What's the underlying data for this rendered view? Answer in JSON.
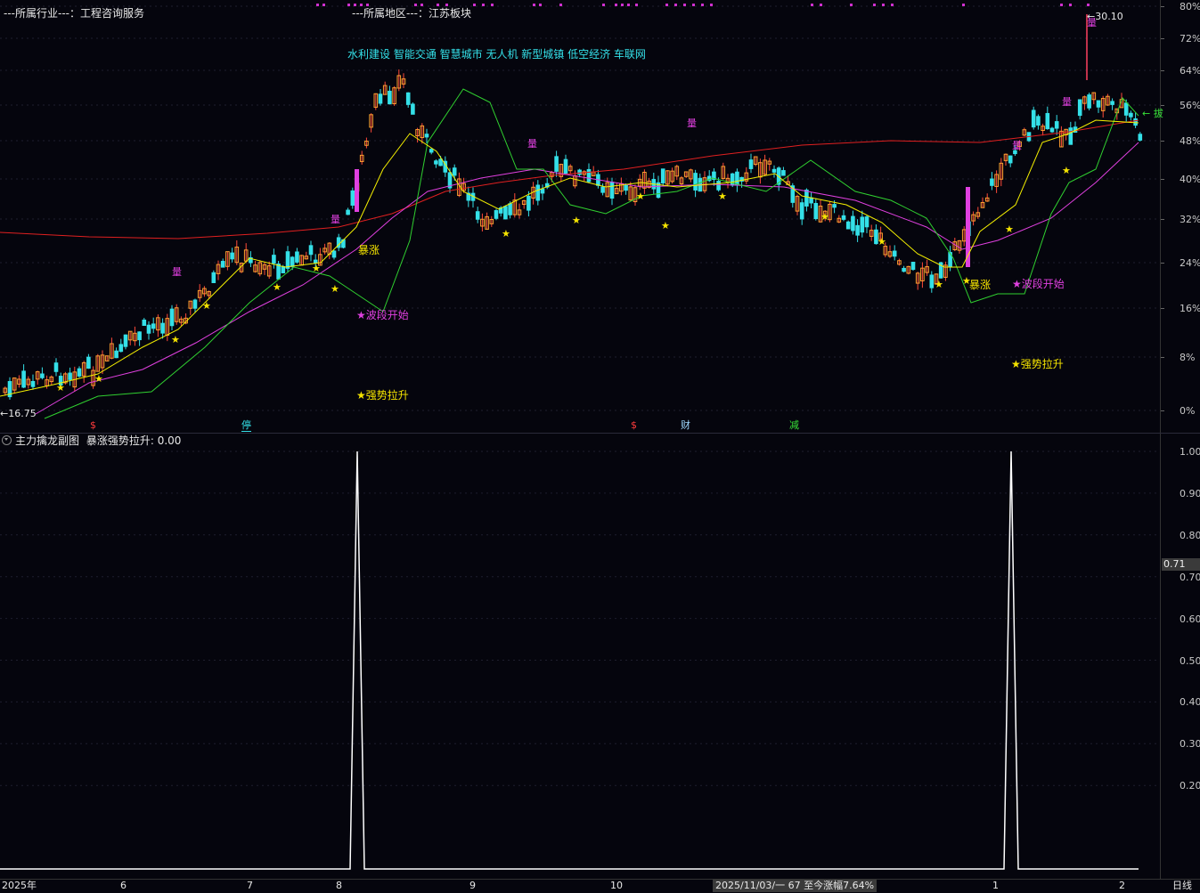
{
  "header": {
    "industry_label": "---所属行业---：工程咨询服务",
    "region_label": "---所属地区---：江苏板块",
    "concepts": "水利建设 智能交通 智慧城市 无人机 新型城镇 低空经济 车联网"
  },
  "price_axis": [
    "80%",
    "72%",
    "64%",
    "56%",
    "48%",
    "40%",
    "32%",
    "24%",
    "16%",
    "8%",
    "0%"
  ],
  "annotations": {
    "low_price": "←16.75",
    "high_price": "←30.10",
    "surge_1": "暴涨",
    "surge_2": "暴涨",
    "wave_start_1": "★波段开始",
    "wave_start_2": "★波段开始",
    "strong_rise_1": "★强势拉升",
    "strong_rise_2": "★强势拉升",
    "right_edge_tag": "← 拔"
  },
  "event_markers": {
    "dividend_1": "$",
    "suspend": "停",
    "dividend_2": "$",
    "finance": "财",
    "reduce": "减"
  },
  "volume_tag": "量",
  "sub_chart": {
    "title": "主力擒龙副图",
    "indicator": "暴涨强势拉升: 0.00",
    "axis": [
      "1.00",
      "0.90",
      "0.80",
      "0.70",
      "0.60",
      "0.50",
      "0.40",
      "0.30",
      "0.20"
    ],
    "current_value": "0.71",
    "chart_data": {
      "type": "line",
      "series": [
        {
          "values": [
            {
              "x": "2025-08-04",
              "y": 1
            },
            {
              "x": "2025-11-05",
              "y": 1
            }
          ]
        }
      ],
      "baseline": 0,
      "ylim": [
        0,
        1
      ]
    }
  },
  "time_axis": [
    "2025年",
    "6",
    "7",
    "8",
    "9",
    "10",
    "1",
    "2"
  ],
  "status": {
    "range_info": "2025/11/03/一 67 至今涨幅7.64%",
    "period": "日线"
  },
  "colors": {
    "up": "#ff5a3c",
    "down": "#34e0e8",
    "ma_short": "#f5f000",
    "ma_mid": "#e040e0",
    "ma_long": "#e02020",
    "band": "#30d030"
  }
}
